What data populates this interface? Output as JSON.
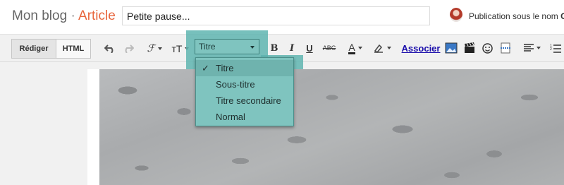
{
  "header": {
    "blog_name": "Mon blog",
    "separator": "·",
    "section": "Article",
    "post_title_value": "Petite pause...",
    "publication_text": "Publication sous le nom ",
    "publication_name_initial": "C"
  },
  "toolbar": {
    "mode_compose": "Rédiger",
    "mode_html": "HTML",
    "undo_icon": "undo-icon",
    "redo_icon": "redo-icon",
    "font_icon_glyph": "ℱ",
    "font_size_glyph": "тT",
    "format_select_value": "Titre",
    "bold": "B",
    "italic": "I",
    "underline": "U",
    "strike": "ABC",
    "text_color_glyph": "A",
    "link_label": "Associer"
  },
  "format_menu": {
    "options": [
      {
        "label": "Titre",
        "selected": true
      },
      {
        "label": "Sous-titre",
        "selected": false
      },
      {
        "label": "Titre secondaire",
        "selected": false
      },
      {
        "label": "Normal",
        "selected": false
      }
    ],
    "check_glyph": "✓"
  },
  "colors": {
    "accent": "#e8663d",
    "highlight": "#5fb5b0",
    "menu_bg": "#7fc4bf",
    "link": "#1a0dab"
  }
}
